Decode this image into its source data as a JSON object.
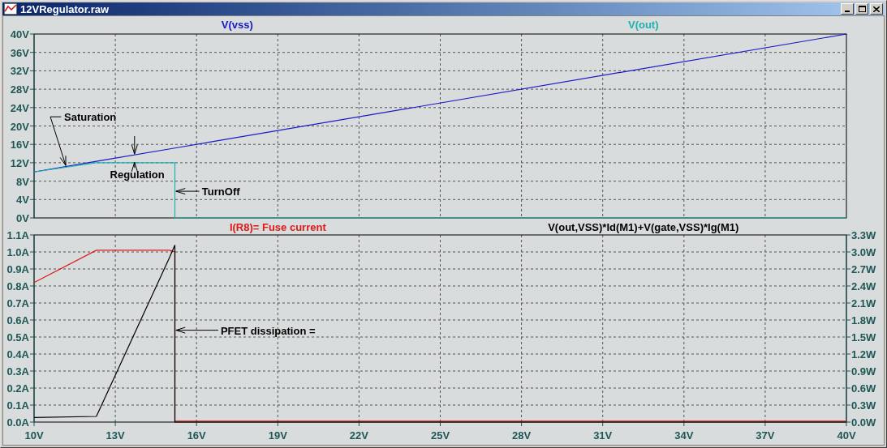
{
  "window": {
    "title": "12VRegulator.raw"
  },
  "plots": [
    {
      "chart_data": {
        "type": "line",
        "grid": true,
        "x": [
          10,
          12.3,
          15.2,
          15.2,
          40
        ],
        "xlim": [
          10,
          40
        ],
        "ylim": [
          0,
          40
        ],
        "yticks": [
          {
            "value": 0,
            "label": "0V"
          },
          {
            "value": 4,
            "label": "4V"
          },
          {
            "value": 8,
            "label": "8V"
          },
          {
            "value": 12,
            "label": "12V"
          },
          {
            "value": 16,
            "label": "16V"
          },
          {
            "value": 20,
            "label": "20V"
          },
          {
            "value": 24,
            "label": "24V"
          },
          {
            "value": 28,
            "label": "28V"
          },
          {
            "value": 32,
            "label": "32V"
          },
          {
            "value": 36,
            "label": "36V"
          },
          {
            "value": 40,
            "label": "40V"
          }
        ],
        "series": [
          {
            "name": "V(vss)",
            "color": "#1818c8",
            "values": [
              10,
              12.3,
              15.2,
              15.2,
              40
            ]
          },
          {
            "name": "V(out)",
            "color": "#20b0b0",
            "values": [
              10,
              12,
              12,
              0,
              0
            ]
          }
        ],
        "annotations": [
          "Saturation",
          "Regulation",
          "TurnOff"
        ]
      }
    },
    {
      "chart_data": {
        "type": "line",
        "grid": true,
        "x": [
          10,
          12.3,
          15.0,
          15.2,
          15.2,
          40
        ],
        "xlim": [
          10,
          40
        ],
        "ylim": [
          0,
          1.1
        ],
        "y2lim": [
          0,
          3.3
        ],
        "xticks": [
          {
            "value": 10,
            "label": "10V"
          },
          {
            "value": 13,
            "label": "13V"
          },
          {
            "value": 16,
            "label": "16V"
          },
          {
            "value": 19,
            "label": "19V"
          },
          {
            "value": 22,
            "label": "22V"
          },
          {
            "value": 25,
            "label": "25V"
          },
          {
            "value": 28,
            "label": "28V"
          },
          {
            "value": 31,
            "label": "31V"
          },
          {
            "value": 34,
            "label": "34V"
          },
          {
            "value": 37,
            "label": "37V"
          },
          {
            "value": 40,
            "label": "40V"
          }
        ],
        "yticks": [
          {
            "value": 0,
            "label": "0.0A"
          },
          {
            "value": 0.1,
            "label": "0.1A"
          },
          {
            "value": 0.2,
            "label": "0.2A"
          },
          {
            "value": 0.3,
            "label": "0.3A"
          },
          {
            "value": 0.4,
            "label": "0.4A"
          },
          {
            "value": 0.5,
            "label": "0.5A"
          },
          {
            "value": 0.6,
            "label": "0.6A"
          },
          {
            "value": 0.7,
            "label": "0.7A"
          },
          {
            "value": 0.8,
            "label": "0.8A"
          },
          {
            "value": 0.9,
            "label": "0.9A"
          },
          {
            "value": 1.0,
            "label": "1.0A"
          },
          {
            "value": 1.1,
            "label": "1.1A"
          }
        ],
        "y2ticks": [
          {
            "value": 0,
            "label": "0.0W"
          },
          {
            "value": 0.3,
            "label": "0.3W"
          },
          {
            "value": 0.6,
            "label": "0.6W"
          },
          {
            "value": 0.9,
            "label": "0.9W"
          },
          {
            "value": 1.2,
            "label": "1.2W"
          },
          {
            "value": 1.5,
            "label": "1.5W"
          },
          {
            "value": 1.8,
            "label": "1.8W"
          },
          {
            "value": 2.1,
            "label": "2.1W"
          },
          {
            "value": 2.4,
            "label": "2.4W"
          },
          {
            "value": 2.7,
            "label": "2.7W"
          },
          {
            "value": 3.0,
            "label": "3.0W"
          },
          {
            "value": 3.3,
            "label": "3.3W"
          }
        ],
        "series": [
          {
            "name": "I(R8)= Fuse current",
            "color": "#e01818",
            "values": [
              0.82,
              1.01,
              1.01,
              1.0,
              0.005,
              0.005
            ]
          },
          {
            "name": "V(out,VSS)*Id(M1)+V(gate,VSS)*Ig(M1)",
            "color": "#000000",
            "axis": "y2",
            "values": [
              0.08,
              0.1,
              2.9,
              3.12,
              0,
              0
            ]
          }
        ],
        "annotations": [
          "PFET dissipation ="
        ]
      }
    }
  ]
}
